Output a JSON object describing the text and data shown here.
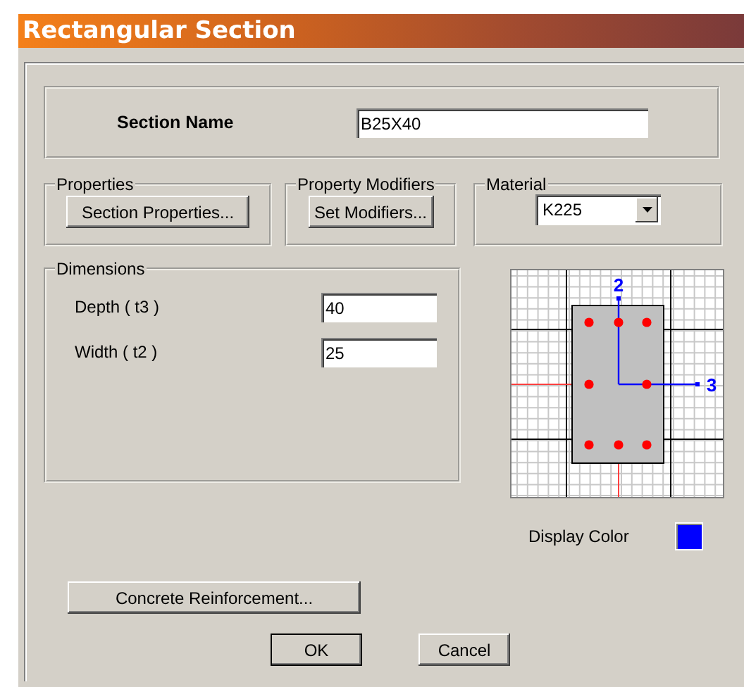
{
  "window": {
    "title": "Rectangular Section"
  },
  "section_name": {
    "label": "Section Name",
    "value": "B25X40"
  },
  "properties": {
    "title": "Properties",
    "button": "Section Properties..."
  },
  "property_modifiers": {
    "title": "Property Modifiers",
    "button": "Set Modifiers..."
  },
  "material": {
    "title": "Material",
    "value": "K225"
  },
  "dimensions": {
    "title": "Dimensions",
    "fields": [
      {
        "label": "Depth ( t3 )",
        "value": "40"
      },
      {
        "label": "Width ( t2 )",
        "value": "25"
      }
    ]
  },
  "section_preview": {
    "axis_labels": [
      "2",
      "3"
    ]
  },
  "display_color": {
    "label": "Display Color",
    "color": "#0000ff"
  },
  "reinforcement_button": "Concrete Reinforcement...",
  "buttons": [
    {
      "label": "OK",
      "default": true
    },
    {
      "label": "Cancel",
      "default": false
    }
  ]
}
